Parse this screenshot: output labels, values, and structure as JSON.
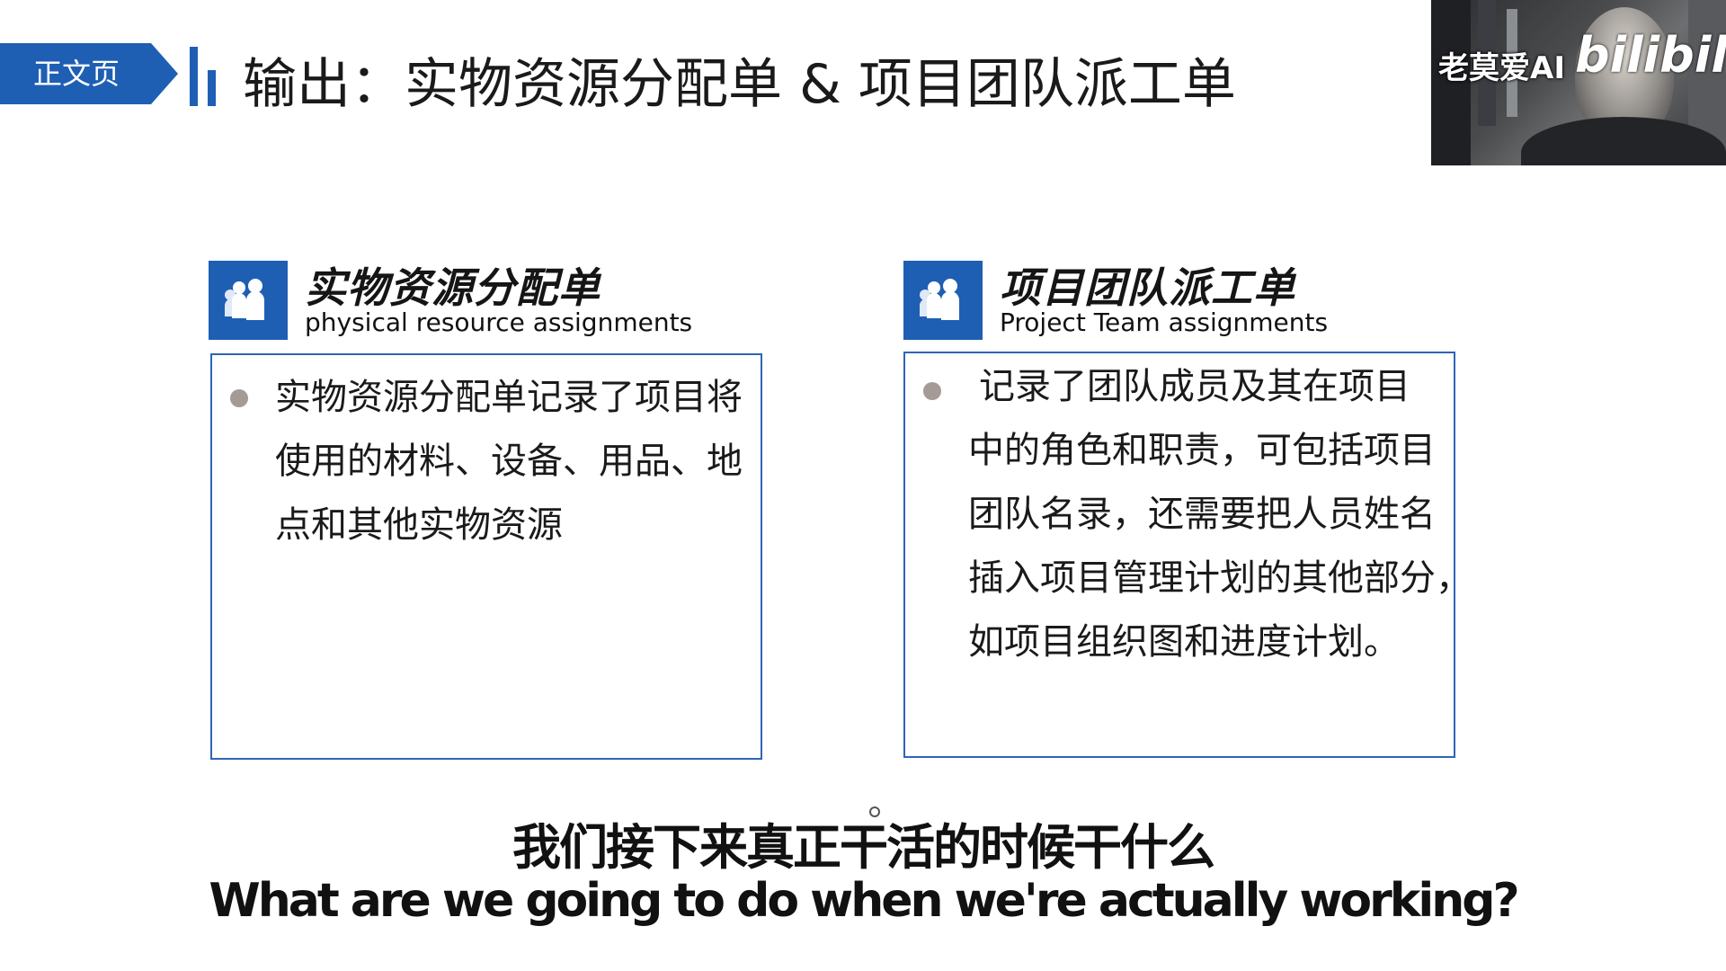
{
  "section_tab": "正文页",
  "page_title": "输出：实物资源分配单 & 项目团队派工单",
  "overlay": {
    "channel_name": "老莫爱AI",
    "brand": "bilibili"
  },
  "cards": [
    {
      "title": "实物资源分配单",
      "subtitle": "physical resource assignments",
      "icon": "people-group-icon",
      "body_lines": [
        "实物资源分配单记录了项目将",
        "使用的材料、设备、用品、地",
        "点和其他实物资源"
      ]
    },
    {
      "title": "项目团队派工单",
      "subtitle": "Project  Team assignments",
      "icon": "people-group-icon",
      "body_lines": [
        "记录了团队成员及其在项目",
        "中的角色和职责，可包括项目",
        "团队名录，还需要把人员姓名",
        "插入项目管理计划的其他部分，",
        "如项目组织图和进度计划。"
      ]
    }
  ],
  "subtitles": {
    "cn": "我们接下来真正干活的时候干什么",
    "en": "What are we going to do when we're actually working?"
  },
  "colors": {
    "accent": "#1e5fb4",
    "box_border": "#2f65b5",
    "bullet": "#a49a96"
  }
}
